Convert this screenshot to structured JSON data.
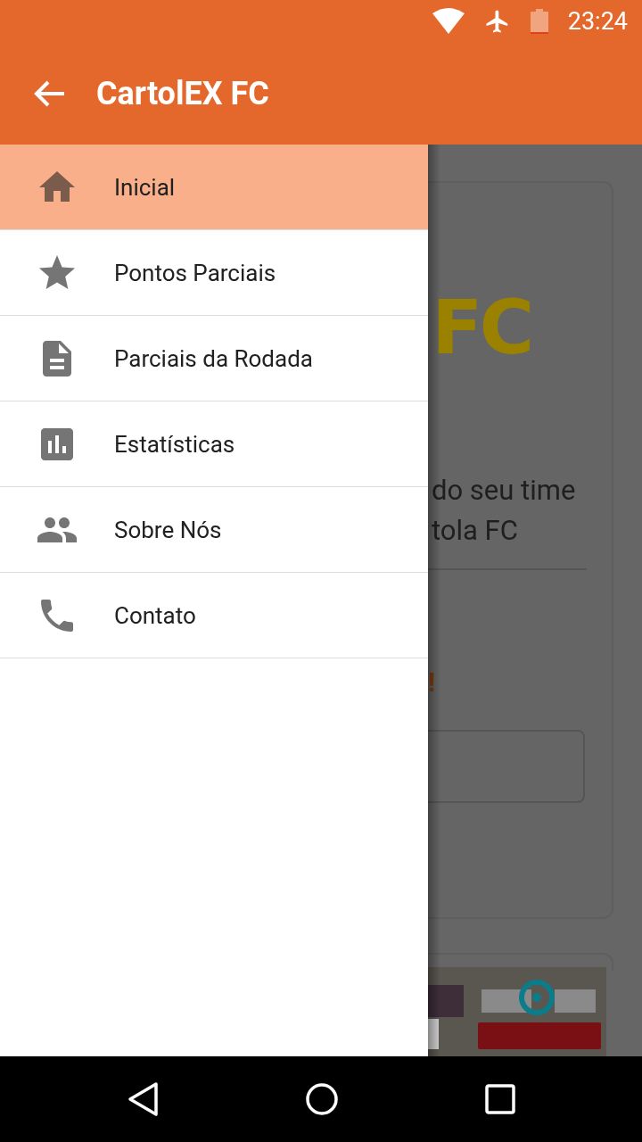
{
  "status_bar": {
    "time": "23:24"
  },
  "app_bar": {
    "title": "CartolEX FC"
  },
  "background": {
    "logo": "FC",
    "description": [
      "do seu time",
      "tola FC"
    ],
    "notice": "!"
  },
  "drawer": {
    "items": [
      {
        "label": "Inicial",
        "kind": "home",
        "selected": true
      },
      {
        "label": "Pontos Parciais",
        "kind": "star",
        "selected": false
      },
      {
        "label": "Parciais da Rodada",
        "kind": "document",
        "selected": false
      },
      {
        "label": "Estatísticas",
        "kind": "chart",
        "selected": false
      },
      {
        "label": "Sobre Nós",
        "kind": "people",
        "selected": false
      },
      {
        "label": "Contato",
        "kind": "phone",
        "selected": false
      }
    ]
  }
}
